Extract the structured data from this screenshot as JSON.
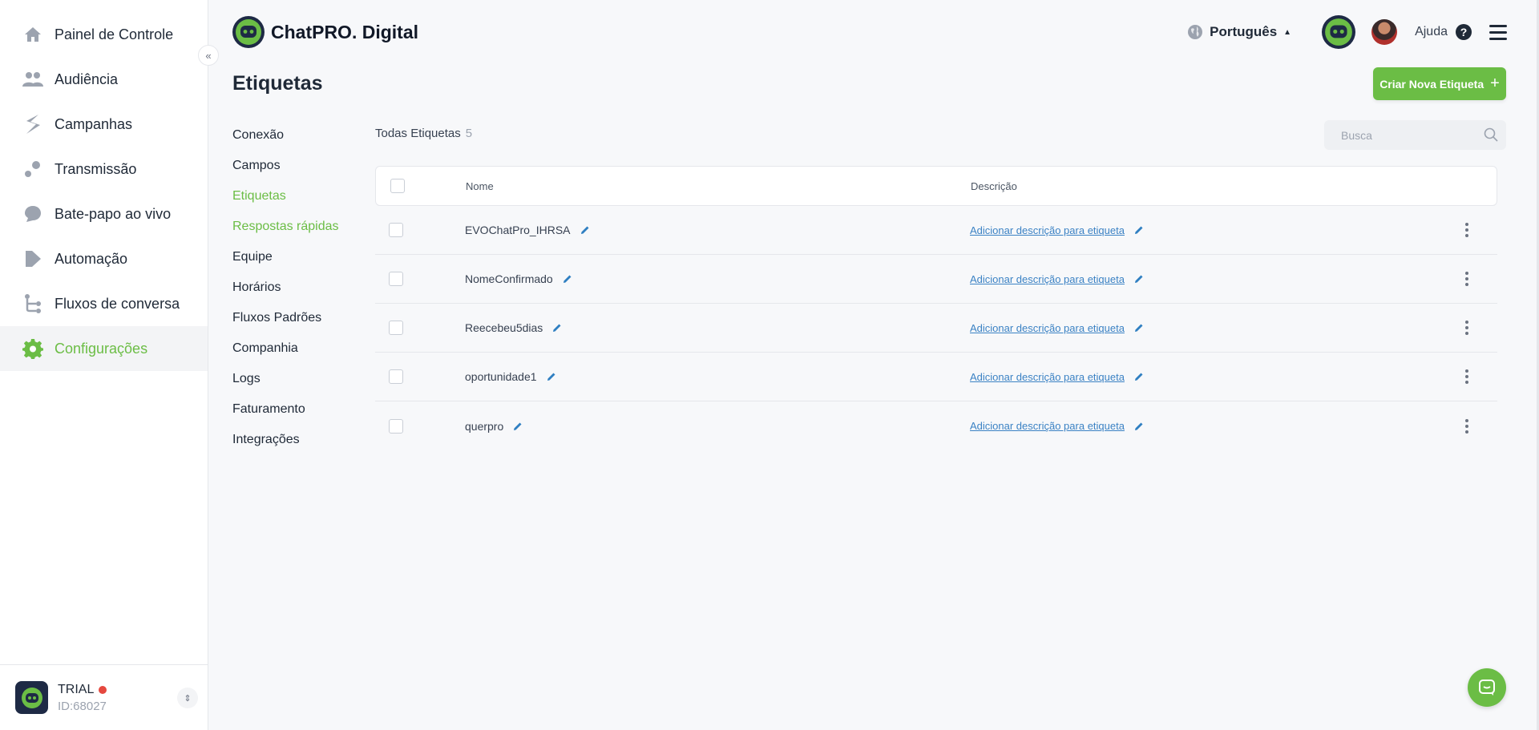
{
  "sidebar": {
    "items": [
      {
        "label": "Painel de Controle",
        "icon": "home-icon"
      },
      {
        "label": "Audiência",
        "icon": "people-icon"
      },
      {
        "label": "Campanhas",
        "icon": "campaign-icon"
      },
      {
        "label": "Transmissão",
        "icon": "broadcast-icon"
      },
      {
        "label": "Bate-papo ao vivo",
        "icon": "chat-bubble-icon"
      },
      {
        "label": "Automação",
        "icon": "automation-icon"
      },
      {
        "label": "Fluxos de conversa",
        "icon": "flow-icon"
      },
      {
        "label": "Configurações",
        "icon": "gear-icon",
        "active": true
      }
    ],
    "collapse_label": "«",
    "account": {
      "plan": "TRIAL",
      "id": "ID:68027"
    }
  },
  "header": {
    "brand": "ChatPRO. Digital",
    "language": "Português",
    "help": "Ajuda"
  },
  "page": {
    "title": "Etiquetas",
    "create_button": "Criar Nova Etiqueta"
  },
  "settings_nav": [
    {
      "label": "Conexão"
    },
    {
      "label": "Campos"
    },
    {
      "label": "Etiquetas",
      "active": true
    },
    {
      "label": "Respostas rápidas",
      "hover": true
    },
    {
      "label": "Equipe"
    },
    {
      "label": "Horários"
    },
    {
      "label": "Fluxos Padrões"
    },
    {
      "label": "Companhia"
    },
    {
      "label": "Logs"
    },
    {
      "label": "Faturamento"
    },
    {
      "label": "Integrações"
    }
  ],
  "list": {
    "heading": "Todas Etiquetas",
    "count": "5",
    "search_placeholder": "Busca",
    "columns": {
      "name": "Nome",
      "description": "Descrição"
    },
    "rows": [
      {
        "name": "EVOChatPro_IHRSA",
        "description": "Adicionar descrição para etiqueta"
      },
      {
        "name": "NomeConfirmado",
        "description": "Adicionar descrição para etiqueta"
      },
      {
        "name": "Reecebeu5dias",
        "description": "Adicionar descrição para etiqueta"
      },
      {
        "name": "oportunidade1",
        "description": "Adicionar descrição para etiqueta"
      },
      {
        "name": "querpro",
        "description": "Adicionar descrição para etiqueta"
      }
    ]
  },
  "colors": {
    "accent": "#6bbd45",
    "link": "#3b82c4",
    "brand_dark": "#1e2a45"
  }
}
